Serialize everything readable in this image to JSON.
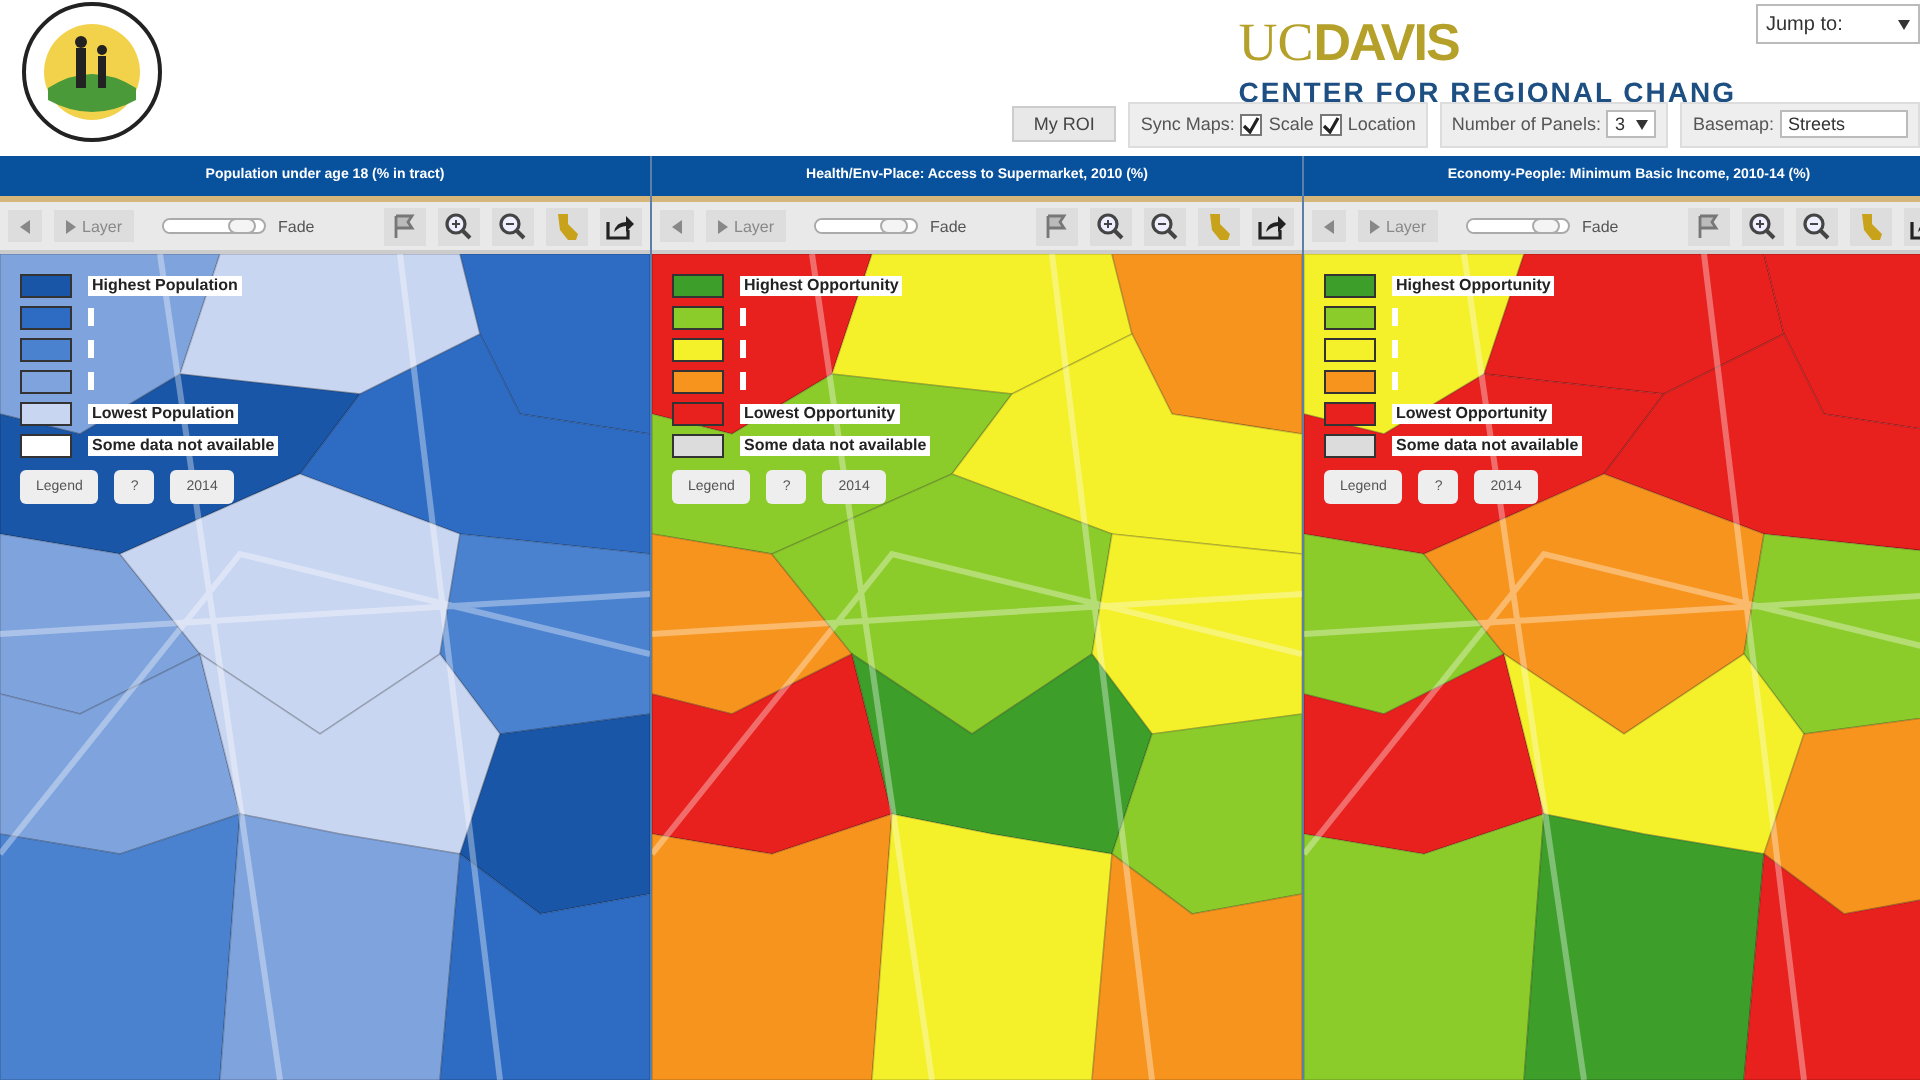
{
  "header": {
    "brand": {
      "top_left": "UC",
      "top_right": "DAVIS",
      "bottom": "CENTER FOR REGIONAL CHANG"
    },
    "jump": {
      "value": "Jump to:"
    }
  },
  "toolbar": {
    "my_roi": "My ROI",
    "sync_label": "Sync Maps:",
    "sync_options": [
      {
        "label": "Scale",
        "checked": true
      },
      {
        "label": "Location",
        "checked": true
      }
    ],
    "panels_label": "Number of Panels:",
    "panels_value": "3",
    "basemap_label": "Basemap:",
    "basemap_value": "Streets"
  },
  "panels": [
    {
      "title": "Population under age 18 (% in tract)",
      "layer_button": "Layer",
      "fade": {
        "level": 0.8,
        "label": "Fade"
      },
      "legend": [
        {
          "color": "#1a56a8",
          "label": "Highest Population"
        },
        {
          "color": "#2e6cc4"
        },
        {
          "color": "#4a82d0"
        },
        {
          "color": "#7fa3dd"
        },
        {
          "color": "#c9d6f2",
          "label": "Lowest Population"
        },
        {
          "color": "#ffffff",
          "label": "Some data not available"
        }
      ],
      "buttons": [
        "Legend",
        "?",
        "2014"
      ]
    },
    {
      "title": "Health/Env-Place: Access to Supermarket, 2010 (%)",
      "layer_button": "Layer",
      "fade": {
        "level": 0.8,
        "label": "Fade"
      },
      "legend": [
        {
          "color": "#3d9e2a",
          "label": "Highest Opportunity"
        },
        {
          "color": "#8ccc2a"
        },
        {
          "color": "#f4f02a"
        },
        {
          "color": "#f7941d"
        },
        {
          "color": "#e8201e",
          "label": "Lowest Opportunity"
        },
        {
          "color": "#dcdcdc",
          "label": "Some data not available"
        }
      ],
      "buttons": [
        "Legend",
        "?",
        "2014"
      ]
    },
    {
      "title": "Economy-People: Minimum Basic Income, 2010-14 (%)",
      "layer_button": "Layer",
      "fade": {
        "level": 0.8,
        "label": "Fade"
      },
      "legend": [
        {
          "color": "#3d9e2a",
          "label": "Highest Opportunity"
        },
        {
          "color": "#8ccc2a"
        },
        {
          "color": "#f4f02a"
        },
        {
          "color": "#f7941d"
        },
        {
          "color": "#e8201e",
          "label": "Lowest Opportunity"
        },
        {
          "color": "#dcdcdc",
          "label": "Some data not available"
        }
      ],
      "buttons": [
        "Legend",
        "?",
        "2014"
      ]
    }
  ]
}
